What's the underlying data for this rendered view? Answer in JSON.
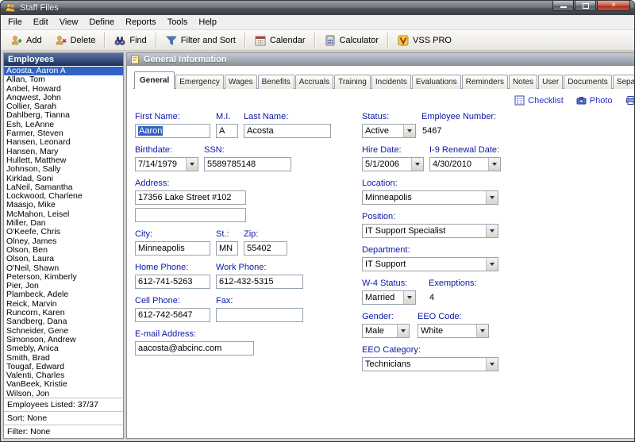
{
  "window": {
    "title": "Staff Files"
  },
  "menu": {
    "items": [
      "File",
      "Edit",
      "View",
      "Define",
      "Reports",
      "Tools",
      "Help"
    ]
  },
  "toolbar": {
    "buttons": [
      {
        "label": "Add"
      },
      {
        "label": "Delete"
      },
      {
        "label": "Find"
      },
      {
        "label": "Filter and Sort"
      },
      {
        "label": "Calendar"
      },
      {
        "label": "Calculator"
      },
      {
        "label": "VSS PRO"
      }
    ]
  },
  "sidebar": {
    "header": "Employees",
    "selected": "Acosta, Aaron A",
    "employees": [
      "Acosta, Aaron A",
      "Allan, Tom",
      "Anbel, Howard",
      "Anqwest, John",
      "Collier, Sarah",
      "Dahlberg, Tianna",
      "Esh, LeAnne",
      "Farmer, Steven",
      "Hansen, Leonard",
      "Hansen, Mary",
      "Hullett, Matthew",
      "Johnson, Sally",
      "Kirklad, Soni",
      "LaNeil, Samantha",
      "Lockwood, Charlene",
      "Maasjo, Mike",
      "McMahon, Leisel",
      "Miller, Dan",
      "O'Keefe, Chris",
      "Olney, James",
      "Olson, Ben",
      "Olson, Laura",
      "O'Neil, Shawn",
      "Peterson, Kimberly",
      "Pier, Jon",
      "Plambeck, Adele",
      "Reick, Marvin",
      "Runcorn, Karen",
      "Sandberg, Dana",
      "Schneider, Gene",
      "Simonson, Andrew",
      "Smebly, Anica",
      "Smith, Brad",
      "Tougaf, Edward",
      "Valenti, Charles",
      "VanBeek, Kristie",
      "Wilson, Jon"
    ],
    "footer": {
      "listed": "Employees Listed: 37/37",
      "sort": "Sort: None",
      "filter": "Filter: None"
    }
  },
  "main": {
    "header": "General Information",
    "active_tab": "General",
    "tabs": [
      "General",
      "Emergency",
      "Wages",
      "Benefits",
      "Accruals",
      "Training",
      "Incidents",
      "Evaluations",
      "Reminders",
      "Notes",
      "User",
      "Documents",
      "Separation"
    ],
    "links": {
      "checklist": "Checklist",
      "photo": "Photo",
      "print": "Print"
    },
    "form": {
      "first_name": {
        "label": "First Name:",
        "value": "Aaron"
      },
      "mi": {
        "label": "M.I.",
        "value": "A"
      },
      "last_name": {
        "label": "Last Name:",
        "value": "Acosta"
      },
      "status": {
        "label": "Status:",
        "value": "Active"
      },
      "employee_number": {
        "label": "Employee Number:",
        "value": "5467"
      },
      "birthdate": {
        "label": "Birthdate:",
        "value": "7/14/1979"
      },
      "ssn": {
        "label": "SSN:",
        "value": "5589785148"
      },
      "hire_date": {
        "label": "Hire Date:",
        "value": "5/1/2006"
      },
      "i9_renewal": {
        "label": "I-9 Renewal Date:",
        "value": "4/30/2010"
      },
      "address": {
        "label": "Address:",
        "value": "17356 Lake Street #102",
        "value2": ""
      },
      "location": {
        "label": "Location:",
        "value": "Minneapolis"
      },
      "position": {
        "label": "Position:",
        "value": "IT Support Specialist"
      },
      "city": {
        "label": "City:",
        "value": "Minneapolis"
      },
      "st": {
        "label": "St.:",
        "value": "MN"
      },
      "zip": {
        "label": "Zip:",
        "value": "55402"
      },
      "department": {
        "label": "Department:",
        "value": "IT Support"
      },
      "home_phone": {
        "label": "Home Phone:",
        "value": "612-741-5263"
      },
      "work_phone": {
        "label": "Work Phone:",
        "value": "612-432-5315"
      },
      "w4_status": {
        "label": "W-4 Status:",
        "value": "Married"
      },
      "exemptions": {
        "label": "Exemptions:",
        "value": "4"
      },
      "cell_phone": {
        "label": "Cell Phone:",
        "value": "612-742-5647"
      },
      "fax": {
        "label": "Fax:",
        "value": ""
      },
      "gender": {
        "label": "Gender:",
        "value": "Male"
      },
      "eeo_code": {
        "label": "EEO Code:",
        "value": "White"
      },
      "email": {
        "label": "E-mail Address:",
        "value": "aacosta@abcinc.com"
      },
      "eeo_category": {
        "label": "EEO Category:",
        "value": "Technicians"
      }
    }
  }
}
